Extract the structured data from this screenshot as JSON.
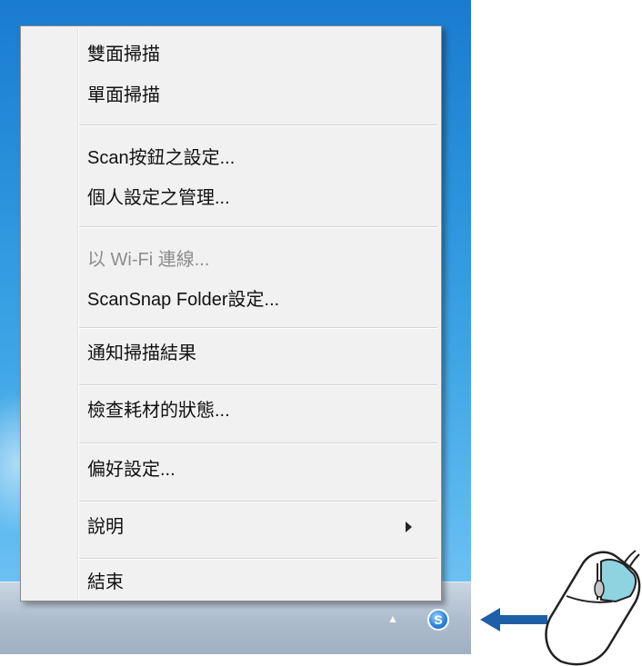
{
  "menu": {
    "items": [
      {
        "label": "雙面掃描",
        "disabled": false
      },
      {
        "label": "單面掃描",
        "disabled": false
      },
      {
        "label": "Scan按鈕之設定...",
        "disabled": false
      },
      {
        "label": "個人設定之管理...",
        "disabled": false
      },
      {
        "label": "以 Wi-Fi 連線...",
        "disabled": true
      },
      {
        "label": "ScanSnap Folder設定...",
        "disabled": false
      },
      {
        "label": "通知掃描結果",
        "disabled": false
      },
      {
        "label": "檢查耗材的狀態...",
        "disabled": false
      },
      {
        "label": "偏好設定...",
        "disabled": false
      },
      {
        "label": "說明",
        "disabled": false,
        "has_submenu": true
      },
      {
        "label": "結束",
        "disabled": false
      }
    ]
  },
  "taskbar": {
    "show_hidden_icons_glyph": "▲",
    "scansnap_icon": "scansnap-manager-icon",
    "scansnap_glyph": "S"
  },
  "illustration": {
    "arrow_color": "#1f5fa8",
    "mouse_button_highlight": "#8fd3e0",
    "icons": [
      "arrow-left-icon",
      "mouse-icon"
    ]
  }
}
